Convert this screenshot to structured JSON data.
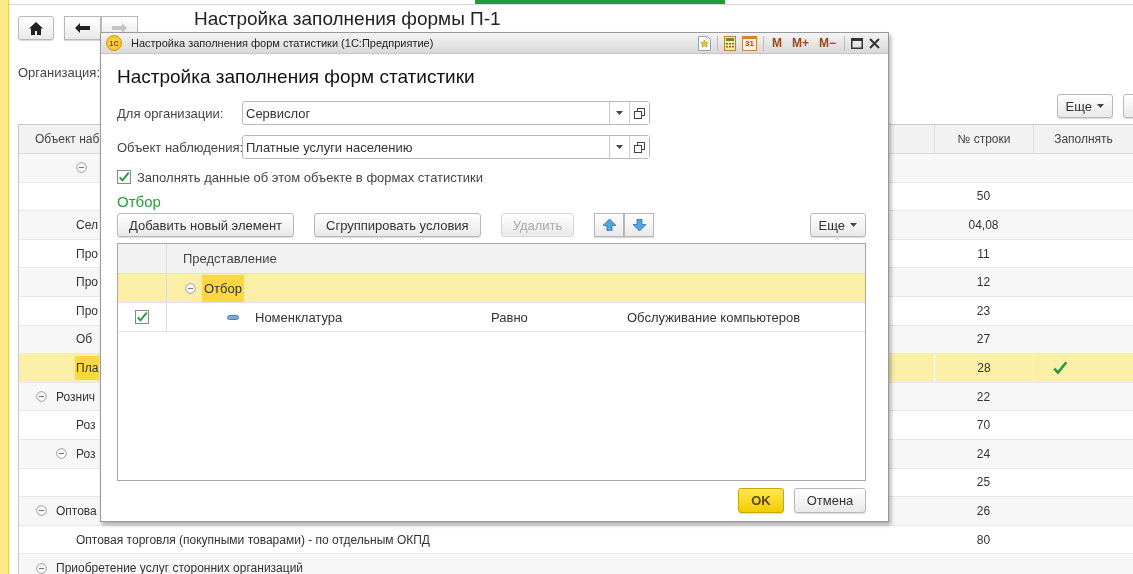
{
  "background": {
    "title": "Настройка заполнения формы П-1",
    "organization_label": "Организация:",
    "more_button": "Еще",
    "table": {
      "columns": [
        "Объект наб",
        "№ строки",
        "Заполнять"
      ],
      "rows": [
        {
          "children": [
            {
              "children": [
                {
                  "expanded": true,
                  "selected": false,
                  "children": [
                    {
                      "number": "50",
                      "fill": false,
                      "selected": false
                    }
                  ]
                }
              ]
            },
            {
              "label": "Сел",
              "number": "04,08",
              "fill": false,
              "selected": false
            },
            {
              "label": "Про",
              "number": "11",
              "fill": false,
              "selected": false
            },
            {
              "label": "Про",
              "number": "12",
              "fill": false,
              "selected": false
            },
            {
              "label": "Про",
              "number": "23",
              "fill": false,
              "selected": false
            },
            {
              "label": "Об",
              "number": "27",
              "fill": false,
              "selected": false
            },
            {
              "label": "Пла",
              "number": "28",
              "fill": true,
              "selected": true
            }
          ]
        },
        {
          "label": "Рознич",
          "expanded": true,
          "number": "22",
          "fill": false,
          "selected": false,
          "children": [
            {
              "label": "Роз",
              "number": "70",
              "fill": false,
              "selected": false
            },
            {
              "label": "Роз",
              "expanded": true,
              "number": "24",
              "fill": false,
              "selected": false,
              "children": [
                {
                  "number": "25",
                  "fill": false,
                  "selected": false
                }
              ]
            }
          ]
        },
        {
          "label": "Оптова",
          "expanded": true,
          "number": "26",
          "fill": false,
          "selected": false,
          "children": [
            {
              "label": "Оптовая торговля (покупными товарами) - по отдельным ОКПД",
              "number": "80",
              "fill": false,
              "selected": false
            }
          ]
        },
        {
          "label": "Приобретение услуг сторонних организаций",
          "expanded": true,
          "selected": false
        }
      ]
    }
  },
  "dialog": {
    "logo": "1С",
    "title": "Настройка заполнения форм статистики (1С:Предприятие)",
    "calendar": "31",
    "memory": [
      "M",
      "M+",
      "M−"
    ],
    "heading": "Настройка заполнения форм статистики",
    "fields": [
      {
        "label": "Для организации:",
        "value": "Сервислог"
      },
      {
        "label": "Объект наблюдения:",
        "value": "Платные услуги населению"
      }
    ],
    "fill_checkbox": {
      "label": "Заполнять данные об этом объекте в формах статистики",
      "checked": true
    },
    "filter": {
      "title": "Отбор",
      "buttons": [
        {
          "label": "Добавить новый элемент",
          "disabled": false
        },
        {
          "label": "Сгруппировать условия",
          "disabled": false
        },
        {
          "label": "Удалить",
          "disabled": true
        }
      ],
      "more_button": "Еще",
      "column": "Представление",
      "items": [
        {
          "kind": "group",
          "label": "Отбор",
          "expanded": true,
          "selected": true,
          "children": [
            {
              "kind": "condition",
              "label": "Номенклатура",
              "checked": true,
              "selected": false,
              "comparison": "Равно",
              "value": "Обслуживание компьютеров"
            }
          ]
        }
      ]
    },
    "buttons": [
      {
        "label": "OK",
        "kind": "default"
      },
      {
        "label": "Отмена",
        "kind": "normal"
      }
    ]
  }
}
